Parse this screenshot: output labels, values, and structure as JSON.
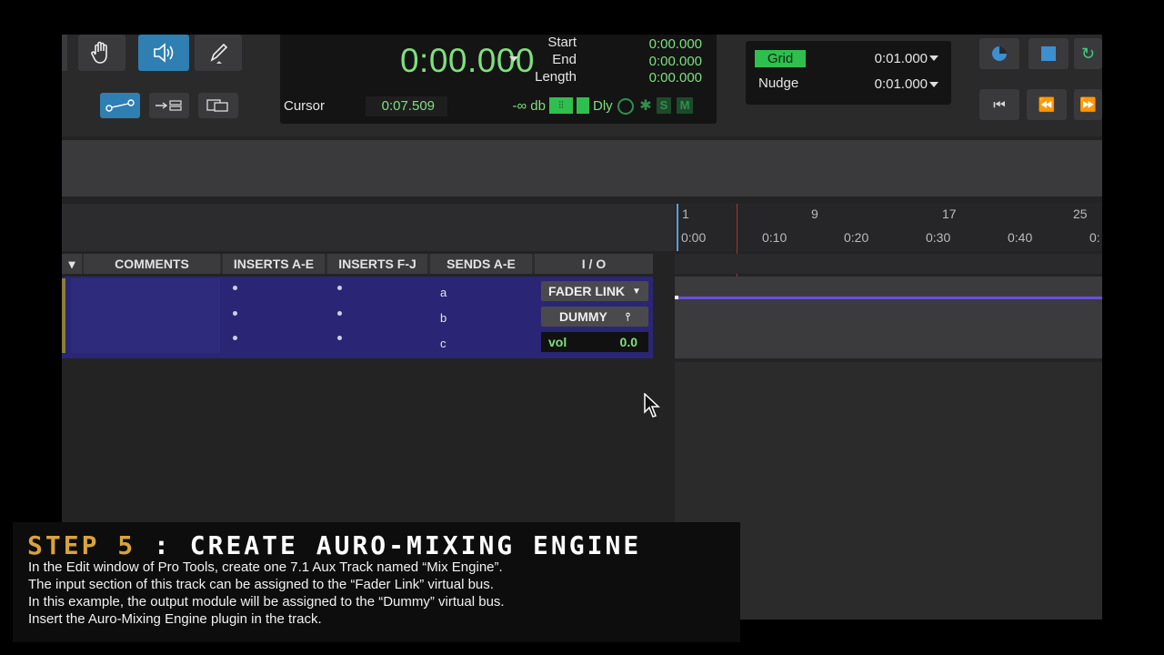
{
  "toolbar": {
    "icons": [
      "hand-icon",
      "speaker-icon",
      "pencil-icon",
      "link-icon",
      "insert-icon",
      "window-icon"
    ],
    "counter": {
      "main": "0:00.000",
      "start_label": "Start",
      "end_label": "End",
      "length_label": "Length",
      "start_value": "0:00.000",
      "end_value": "0:00.000",
      "length_value": "0:00.000",
      "cursor_label": "Cursor",
      "cursor_value": "0:07.509",
      "level": "-∞ db",
      "dly": "Dly",
      "s": "S",
      "m": "M"
    },
    "grid": {
      "grid_label": "Grid",
      "grid_value": "0:01.000",
      "nudge_label": "Nudge",
      "nudge_value": "0:01.000"
    }
  },
  "ruler": {
    "bars": [
      "1",
      "9",
      "17",
      "25"
    ],
    "times": [
      "0:00",
      "0:10",
      "0:20",
      "0:30",
      "0:40",
      "0:"
    ]
  },
  "columns": {
    "comments": "COMMENTS",
    "inserts_ae": "INSERTS A-E",
    "inserts_fj": "INSERTS F-J",
    "sends_ae": "SENDS A-E",
    "io": "I / O"
  },
  "track": {
    "sends": [
      "a",
      "b",
      "c"
    ],
    "input": "FADER LINK",
    "output": "DUMMY",
    "vol_label": "vol",
    "vol_value": "0.0"
  },
  "step": {
    "number": "STEP 5",
    "separator": ":",
    "title": "CREATE AURO-MIXING ENGINE",
    "lines": [
      "In the Edit window of Pro Tools, create one 7.1 Aux Track named “Mix Engine”.",
      "The input section of this track can be assigned to the “Fader Link” virtual bus.",
      "In this example, the output module will be assigned to the “Dummy” virtual bus.",
      "Insert the Auro-Mixing Engine plugin in the track."
    ]
  },
  "colors": {
    "accent": "#2f7fb3",
    "counter_green": "#7ee07e",
    "track_purple": "#2a2675",
    "step_gold": "#d9a33c"
  }
}
